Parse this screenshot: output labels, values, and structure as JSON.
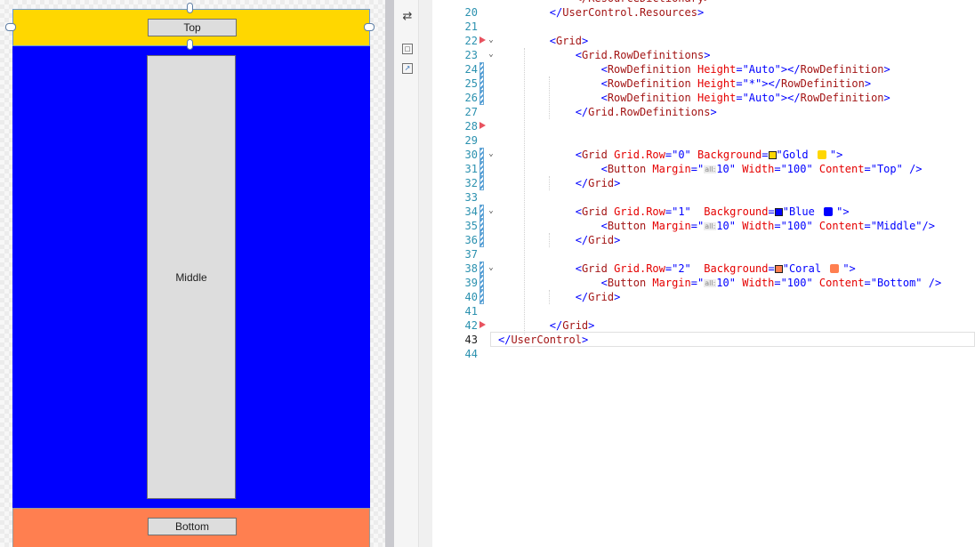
{
  "designer": {
    "colors": {
      "gold": "#FFD700",
      "blue": "#0000FF",
      "coral": "#FF7F50"
    },
    "buttons": {
      "top": "Top",
      "middle": "Middle",
      "bottom": "Bottom"
    }
  },
  "toolstrip": {
    "icons": [
      "swap-panes-icon",
      "zoom-frame-icon",
      "popout-icon"
    ]
  },
  "editor": {
    "colors": {
      "tag": "#a31515",
      "attr": "#e50000",
      "value": "#0000ff",
      "punct": "#0000ff",
      "linenumber": "#2b91af"
    },
    "lines": [
      {
        "n": "20",
        "t": [
          [
            "        ",
            "p"
          ],
          [
            "</",
            "p"
          ],
          [
            "UserControl.Resources",
            "k"
          ],
          [
            ">",
            "p"
          ]
        ]
      },
      {
        "n": "21",
        "t": []
      },
      {
        "n": "22",
        "t": [
          [
            "        ",
            "p"
          ],
          [
            "<",
            "p"
          ],
          [
            "Grid",
            "k"
          ],
          [
            ">",
            "p"
          ]
        ]
      },
      {
        "n": "23",
        "t": [
          [
            "            ",
            "p"
          ],
          [
            "<",
            "p"
          ],
          [
            "Grid.RowDefinitions",
            "k"
          ],
          [
            ">",
            "p"
          ]
        ]
      },
      {
        "n": "24",
        "t": [
          [
            "                ",
            "p"
          ],
          [
            "<",
            "p"
          ],
          [
            "RowDefinition",
            "k"
          ],
          [
            " Height",
            "a"
          ],
          [
            "=",
            "p"
          ],
          [
            "\"Auto\"",
            "v"
          ],
          [
            "></",
            "p"
          ],
          [
            "RowDefinition",
            "k"
          ],
          [
            ">",
            "p"
          ]
        ]
      },
      {
        "n": "25",
        "t": [
          [
            "                ",
            "p"
          ],
          [
            "<",
            "p"
          ],
          [
            "RowDefinition",
            "k"
          ],
          [
            " Height",
            "a"
          ],
          [
            "=",
            "p"
          ],
          [
            "\"*\"",
            "v"
          ],
          [
            "></",
            "p"
          ],
          [
            "RowDefinition",
            "k"
          ],
          [
            ">",
            "p"
          ]
        ]
      },
      {
        "n": "26",
        "t": [
          [
            "                ",
            "p"
          ],
          [
            "<",
            "p"
          ],
          [
            "RowDefinition",
            "k"
          ],
          [
            " Height",
            "a"
          ],
          [
            "=",
            "p"
          ],
          [
            "\"Auto\"",
            "v"
          ],
          [
            "></",
            "p"
          ],
          [
            "RowDefinition",
            "k"
          ],
          [
            ">",
            "p"
          ]
        ]
      },
      {
        "n": "27",
        "t": [
          [
            "            ",
            "p"
          ],
          [
            "</",
            "p"
          ],
          [
            "Grid.RowDefinitions",
            "k"
          ],
          [
            ">",
            "p"
          ]
        ]
      },
      {
        "n": "28",
        "t": []
      },
      {
        "n": "29",
        "t": []
      },
      {
        "n": "30",
        "t": [
          [
            "            ",
            "p"
          ],
          [
            "<",
            "p"
          ],
          [
            "Grid",
            "k"
          ],
          [
            " Grid.Row",
            "a"
          ],
          [
            "=",
            "p"
          ],
          [
            "\"0\"",
            "v"
          ],
          [
            " Background",
            "a"
          ],
          [
            "=",
            "p"
          ],
          [
            "#swatch:gold",
            "s"
          ],
          [
            "\"Gold ",
            "v"
          ],
          [
            "#dot:gold",
            "d"
          ],
          [
            "\"",
            "v"
          ],
          [
            ">",
            "p"
          ]
        ]
      },
      {
        "n": "31",
        "t": [
          [
            "                ",
            "p"
          ],
          [
            "<",
            "p"
          ],
          [
            "Button",
            "k"
          ],
          [
            " Margin",
            "a"
          ],
          [
            "=",
            "p"
          ],
          [
            "\"",
            "v"
          ],
          [
            "all:",
            "h"
          ],
          [
            "10\"",
            "v"
          ],
          [
            " Width",
            "a"
          ],
          [
            "=",
            "p"
          ],
          [
            "\"100\"",
            "v"
          ],
          [
            " Content",
            "a"
          ],
          [
            "=",
            "p"
          ],
          [
            "\"Top\"",
            "v"
          ],
          [
            " />",
            "p"
          ]
        ]
      },
      {
        "n": "32",
        "t": [
          [
            "            ",
            "p"
          ],
          [
            "</",
            "p"
          ],
          [
            "Grid",
            "k"
          ],
          [
            ">",
            "p"
          ]
        ]
      },
      {
        "n": "33",
        "t": []
      },
      {
        "n": "34",
        "t": [
          [
            "            ",
            "p"
          ],
          [
            "<",
            "p"
          ],
          [
            "Grid",
            "k"
          ],
          [
            " Grid.Row",
            "a"
          ],
          [
            "=",
            "p"
          ],
          [
            "\"1\"",
            "v"
          ],
          [
            "  Background",
            "a"
          ],
          [
            "=",
            "p"
          ],
          [
            "#swatch:blue",
            "s"
          ],
          [
            "\"Blue ",
            "v"
          ],
          [
            "#dot:blue",
            "d"
          ],
          [
            "\"",
            "v"
          ],
          [
            ">",
            "p"
          ]
        ]
      },
      {
        "n": "35",
        "t": [
          [
            "                ",
            "p"
          ],
          [
            "<",
            "p"
          ],
          [
            "Button",
            "k"
          ],
          [
            " Margin",
            "a"
          ],
          [
            "=",
            "p"
          ],
          [
            "\"",
            "v"
          ],
          [
            "all:",
            "h"
          ],
          [
            "10\"",
            "v"
          ],
          [
            " Width",
            "a"
          ],
          [
            "=",
            "p"
          ],
          [
            "\"100\"",
            "v"
          ],
          [
            " Content",
            "a"
          ],
          [
            "=",
            "p"
          ],
          [
            "\"Middle\"",
            "v"
          ],
          [
            "/>",
            "p"
          ]
        ]
      },
      {
        "n": "36",
        "t": [
          [
            "            ",
            "p"
          ],
          [
            "</",
            "p"
          ],
          [
            "Grid",
            "k"
          ],
          [
            ">",
            "p"
          ]
        ]
      },
      {
        "n": "37",
        "t": []
      },
      {
        "n": "38",
        "t": [
          [
            "            ",
            "p"
          ],
          [
            "<",
            "p"
          ],
          [
            "Grid",
            "k"
          ],
          [
            " Grid.Row",
            "a"
          ],
          [
            "=",
            "p"
          ],
          [
            "\"2\"",
            "v"
          ],
          [
            "  Background",
            "a"
          ],
          [
            "=",
            "p"
          ],
          [
            "#swatch:coral",
            "s"
          ],
          [
            "\"Coral ",
            "v"
          ],
          [
            "#dot:coral",
            "d"
          ],
          [
            "\"",
            "v"
          ],
          [
            ">",
            "p"
          ]
        ]
      },
      {
        "n": "39",
        "t": [
          [
            "                ",
            "p"
          ],
          [
            "<",
            "p"
          ],
          [
            "Button",
            "k"
          ],
          [
            " Margin",
            "a"
          ],
          [
            "=",
            "p"
          ],
          [
            "\"",
            "v"
          ],
          [
            "all:",
            "h"
          ],
          [
            "10\"",
            "v"
          ],
          [
            " Width",
            "a"
          ],
          [
            "=",
            "p"
          ],
          [
            "\"100\"",
            "v"
          ],
          [
            " Content",
            "a"
          ],
          [
            "=",
            "p"
          ],
          [
            "\"Bottom\"",
            "v"
          ],
          [
            " />",
            "p"
          ]
        ]
      },
      {
        "n": "40",
        "t": [
          [
            "            ",
            "p"
          ],
          [
            "</",
            "p"
          ],
          [
            "Grid",
            "k"
          ],
          [
            ">",
            "p"
          ]
        ]
      },
      {
        "n": "41",
        "t": []
      },
      {
        "n": "42",
        "t": [
          [
            "        ",
            "p"
          ],
          [
            "</",
            "p"
          ],
          [
            "Grid",
            "k"
          ],
          [
            ">",
            "p"
          ]
        ]
      },
      {
        "n": "43",
        "t": [
          [
            "",
            "p"
          ],
          [
            "</",
            "p"
          ],
          [
            "UserControl",
            "k"
          ],
          [
            ">",
            "p"
          ]
        ]
      },
      {
        "n": "44",
        "t": []
      }
    ],
    "markers": {
      "breakpoint_lines": [
        "22",
        "28",
        "36",
        "40",
        "42"
      ],
      "change_lines": [
        "24",
        "25",
        "26",
        "30",
        "31",
        "32",
        "34",
        "35",
        "36",
        "38",
        "39",
        "40"
      ],
      "fold_lines": [
        "22",
        "23",
        "30",
        "34",
        "38"
      ],
      "current_line": "43"
    }
  }
}
